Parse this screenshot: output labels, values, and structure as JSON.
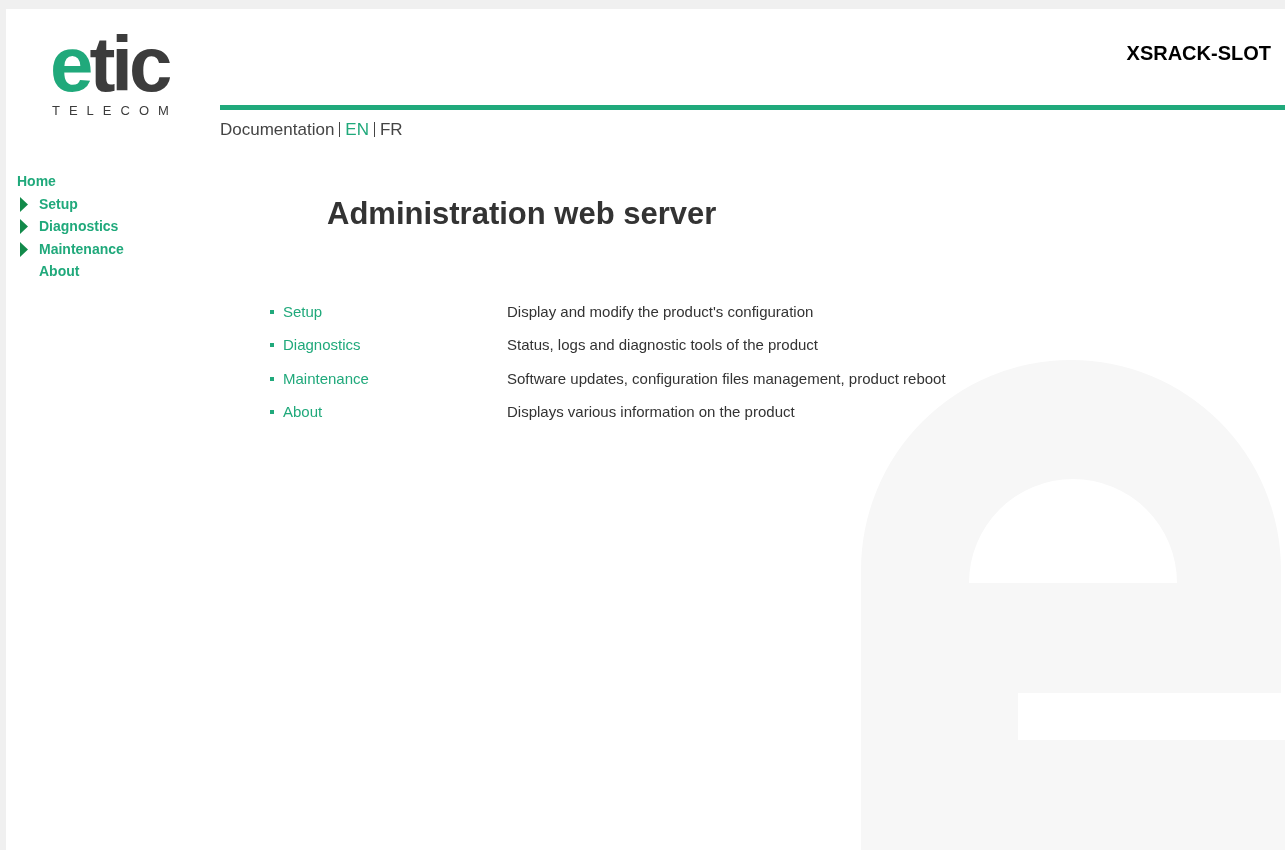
{
  "logo": {
    "text": "etic",
    "subtitle": "TELECOM"
  },
  "device_name": "XSRACK-SLOT",
  "top_links": [
    {
      "label": "Documentation",
      "selected": false
    },
    {
      "label": "EN",
      "selected": true
    },
    {
      "label": "FR",
      "selected": false
    }
  ],
  "sidebar": {
    "items": [
      {
        "label": "Home",
        "kind": "top"
      },
      {
        "label": "Setup",
        "kind": "folder",
        "expanded": false
      },
      {
        "label": "Diagnostics",
        "kind": "folder",
        "expanded": false
      },
      {
        "label": "Maintenance",
        "kind": "folder",
        "expanded": false
      },
      {
        "label": "About",
        "kind": "page"
      }
    ]
  },
  "heading": "Administration web server",
  "sections": [
    {
      "label": "Setup",
      "description": "Display and modify the product's configuration"
    },
    {
      "label": "Diagnostics",
      "description": "Status, logs and diagnostic tools of the product"
    },
    {
      "label": "Maintenance",
      "description": "Software updates, configuration files management, product reboot"
    },
    {
      "label": "About",
      "description": "Displays various information on the product"
    }
  ]
}
